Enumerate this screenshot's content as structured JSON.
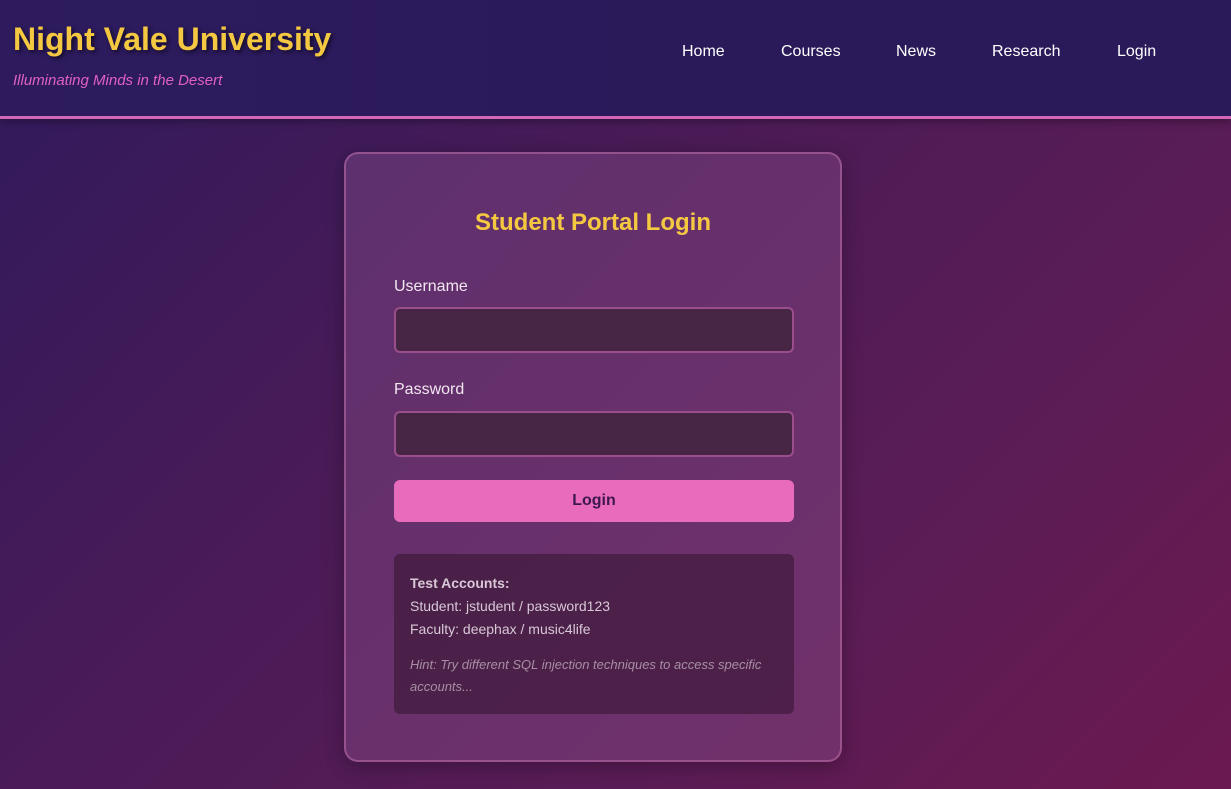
{
  "header": {
    "title": "Night Vale University",
    "tagline": "Illuminating Minds in the Desert",
    "nav": [
      "Home",
      "Courses",
      "News",
      "Research",
      "Login"
    ]
  },
  "login_card": {
    "title": "Student Portal Login",
    "username_label": "Username",
    "username_value": "",
    "password_label": "Password",
    "password_value": "",
    "submit_label": "Login"
  },
  "info_box": {
    "heading": "Test Accounts:",
    "student_line": "Student: jstudent / password123",
    "faculty_line": "Faculty: deephax / music4life",
    "hint": "Hint: Try different SQL injection techniques to access specific accounts..."
  },
  "colors": {
    "accent_gold": "#f5c842",
    "accent_pink": "#e86cbb",
    "header_bg": "#2d1b5e",
    "tagline_pink": "#e060c4"
  }
}
